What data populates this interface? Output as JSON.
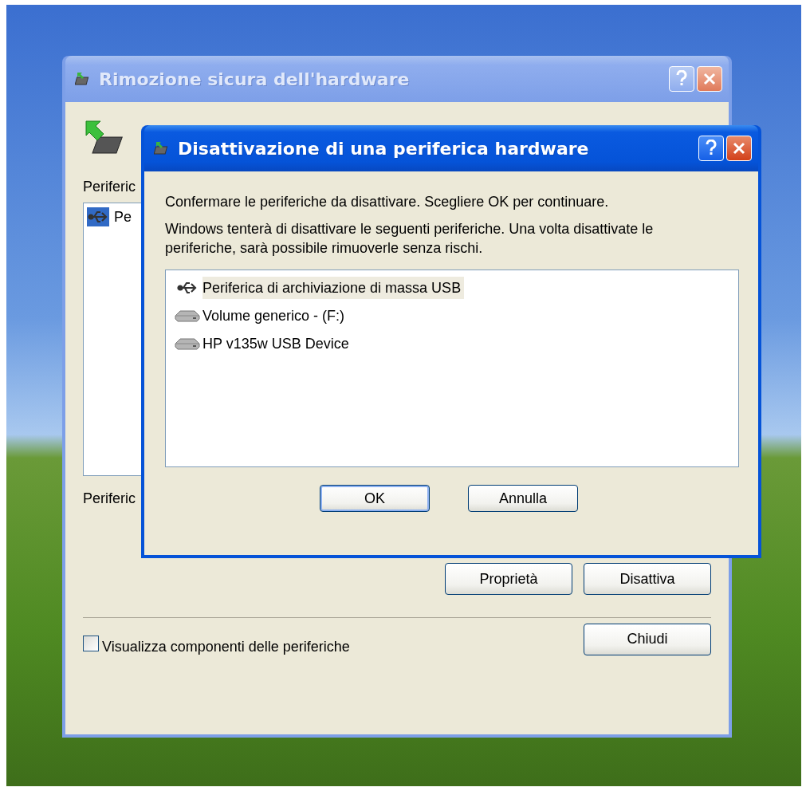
{
  "back_window": {
    "title": "Rimozione sicura dell'hardware",
    "active": false,
    "list_label": "Periferic",
    "devices": [
      {
        "label": "Pe",
        "kind": "usb",
        "selected": true
      }
    ],
    "details_label": "Periferic",
    "buttons": [
      {
        "label": "Proprietà",
        "default": false
      },
      {
        "label": "Disattiva",
        "default": false
      }
    ],
    "show_components": {
      "label": "Visualizza componenti delle periferiche",
      "checked": false
    },
    "close_button": {
      "label": "Chiudi",
      "default": false
    }
  },
  "dialog": {
    "title": "Disattivazione di una periferica hardware",
    "active": true,
    "prompt": "Confermare le periferiche da disattivare. Scegliere OK per continuare.",
    "description": "Windows tenterà di disattivare le seguenti periferiche. Una volta disattivate le periferiche, sarà possibile rimuoverle senza rischi.",
    "devices": [
      {
        "label": "Periferica di archiviazione di massa USB",
        "kind": "usb",
        "selected": true
      },
      {
        "label": "Volume generico - (F:)",
        "kind": "drive",
        "selected": false
      },
      {
        "label": "HP v135w USB Device",
        "kind": "drive",
        "selected": false
      }
    ],
    "buttons": [
      {
        "label": "OK",
        "default": true
      },
      {
        "label": "Annulla",
        "default": false
      }
    ]
  }
}
